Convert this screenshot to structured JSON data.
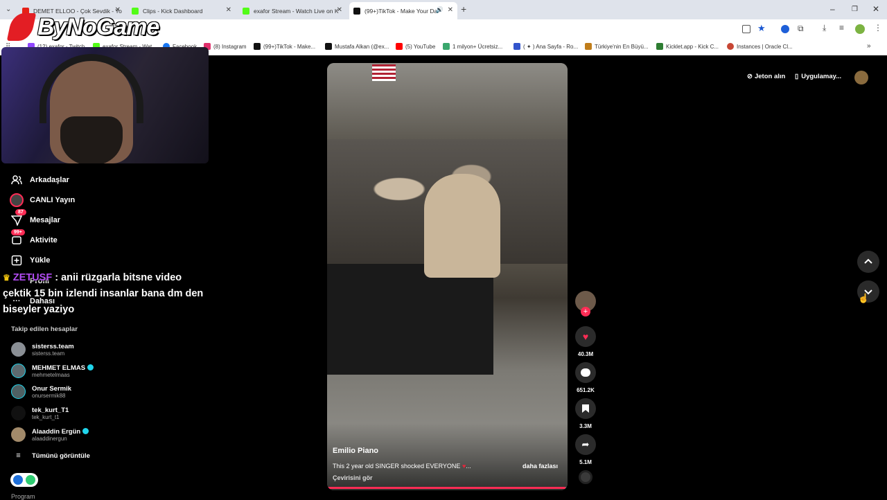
{
  "tabs": [
    {
      "title": "DEMET ELLOO - Çok Sevdik - Yo",
      "color": "#e62117"
    },
    {
      "title": "Clips - Kick Dashboard",
      "color": "#53fc18"
    },
    {
      "title": "exafor Stream - Watch Live on K",
      "color": "#53fc18"
    },
    {
      "title": "(99+)TikTok - Make Your Da",
      "color": "#111111"
    }
  ],
  "bookmarks": [
    {
      "label": "(12) exafor - Twitch",
      "color": "#9146ff"
    },
    {
      "label": "exafor Stream - Wat...",
      "color": "#53fc18"
    },
    {
      "label": "Facebook",
      "color": "#1877f2"
    },
    {
      "label": "(8) Instagram",
      "color": "#e1306c"
    },
    {
      "label": "(99+)TikTok - Make...",
      "color": "#111111"
    },
    {
      "label": "Mustafa Alkan (@ex...",
      "color": "#111111"
    },
    {
      "label": "(5) YouTube",
      "color": "#ff0000"
    },
    {
      "label": "1 milyon+ Ücretsiz...",
      "color": "#3aa76d"
    },
    {
      "label": "( ✦ ) Ana Sayfa - Ro...",
      "color": "#3355cc"
    },
    {
      "label": "Türkiye'nin En Büyü...",
      "color": "#c07d1a"
    },
    {
      "label": "Kicklet.app - Kick C...",
      "color": "#2e7d32"
    },
    {
      "label": "Instances | Oracle Cl...",
      "color": "#c74634"
    }
  ],
  "overlay": {
    "logo": "ByNoGame"
  },
  "nav": [
    {
      "label": "Arkadaşlar",
      "icon": "friends-icon"
    },
    {
      "label": "CANLI Yayın",
      "icon": "live-icon"
    },
    {
      "label": "Mesajlar",
      "icon": "messages-icon",
      "badge": "87"
    },
    {
      "label": "Aktivite",
      "icon": "activity-icon",
      "badge": "99+"
    },
    {
      "label": "Yükle",
      "icon": "upload-icon"
    },
    {
      "label": "Profil",
      "icon": "profile-icon"
    },
    {
      "label": "Dahası",
      "icon": "more-icon"
    }
  ],
  "chat": {
    "user": "ZETUSF",
    "message": " : anii rüzgarla bitsne video çektik 15 bin izlendi insanlar bana dm den biseyler yaziyo"
  },
  "following": {
    "title": "Takip edilen hesaplar",
    "accounts": [
      {
        "name": "sisterss.team",
        "handle": "sisterss.team",
        "verified": false
      },
      {
        "name": "MEHMET ELMAS",
        "handle": "mehmetelmaas",
        "verified": true
      },
      {
        "name": "Onur Sermik",
        "handle": "onursermik88",
        "verified": false
      },
      {
        "name": "tek_kurt_T1",
        "handle": "tek_kurt_t1",
        "verified": false
      },
      {
        "name": "Alaaddin Ergün",
        "handle": "alaaddinergun",
        "verified": true
      }
    ],
    "see_all": "Tümünü görüntüle"
  },
  "footer": {
    "program": "Program"
  },
  "header": {
    "coins": "Jeton alın",
    "app": "Uygulamay..."
  },
  "video": {
    "author": "Emilio Piano",
    "caption": "This 2 year old SINGER shocked EVERYONE",
    "more": "daha fazlası",
    "translate": "Çevirisini gör",
    "progress": 0.99
  },
  "actions": {
    "likes": "40.3M",
    "comments": "651.2K",
    "saves": "3.3M",
    "shares": "5.1M"
  }
}
